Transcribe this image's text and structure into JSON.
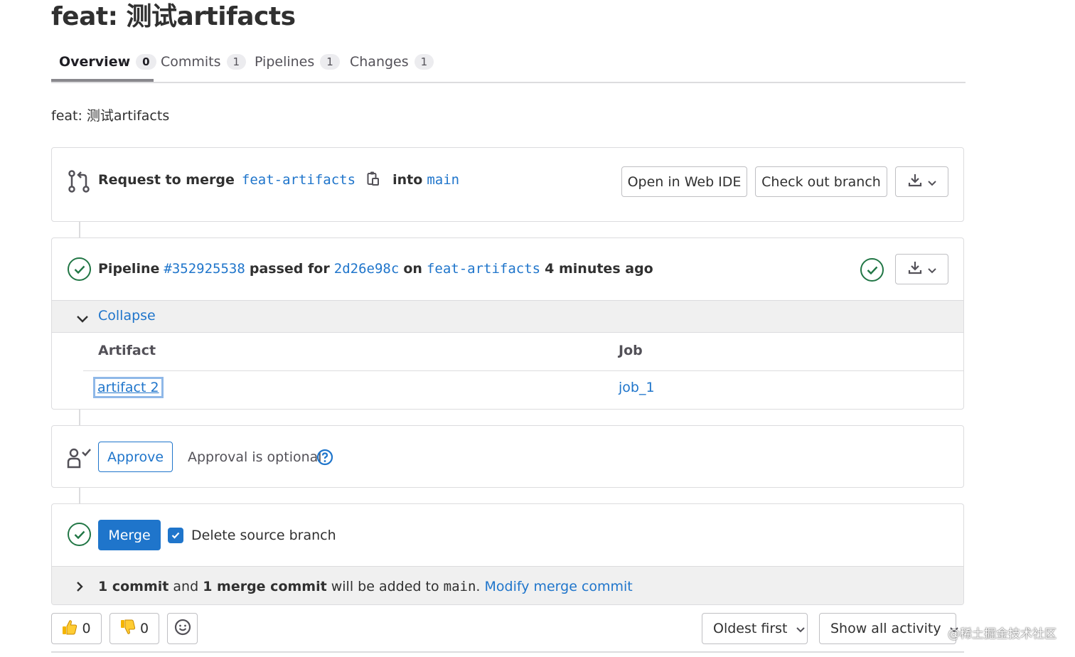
{
  "page": {
    "title": "feat: 测试artifacts",
    "description": "feat: 测试artifacts"
  },
  "tabs": [
    {
      "label": "Overview",
      "count": "0",
      "active": true
    },
    {
      "label": "Commits",
      "count": "1",
      "active": false
    },
    {
      "label": "Pipelines",
      "count": "1",
      "active": false
    },
    {
      "label": "Changes",
      "count": "1",
      "active": false
    }
  ],
  "merge_request": {
    "request_label": "Request to merge",
    "source_branch": "feat-artifacts",
    "into_label": "into",
    "target_branch": "main",
    "open_web_ide": "Open in Web IDE",
    "check_out_branch": "Check out branch"
  },
  "pipeline": {
    "label": "Pipeline",
    "id": "#352925538",
    "passed_for": "passed for",
    "commit": "2d26e98c",
    "on_label": "on",
    "branch": "feat-artifacts",
    "time": "4 minutes ago",
    "collapse_label": "Collapse",
    "table_headers": {
      "artifact": "Artifact",
      "job": "Job"
    },
    "artifacts": [
      {
        "artifact": "artifact 2",
        "job": "job_1"
      }
    ]
  },
  "approval": {
    "approve_label": "Approve",
    "optional_text": "Approval is optional"
  },
  "merge": {
    "merge_label": "Merge",
    "delete_branch_label": "Delete source branch",
    "delete_branch_checked": true,
    "commit_count": "1 commit",
    "and_label": "and",
    "merge_commit_count": "1 merge commit",
    "added_to": "will be added to",
    "target": "main",
    "period": ".",
    "modify_label": "Modify merge commit"
  },
  "footer": {
    "thumbs_up_count": "0",
    "thumbs_down_count": "0",
    "sort_label": "Oldest first",
    "filter_label": "Show all activity"
  },
  "watermark": "@稀土掘金技术社区",
  "colors": {
    "link": "#1f75cb",
    "success": "#217645",
    "border": "#dcdcde",
    "collapse_bg": "#f0f0f0"
  }
}
